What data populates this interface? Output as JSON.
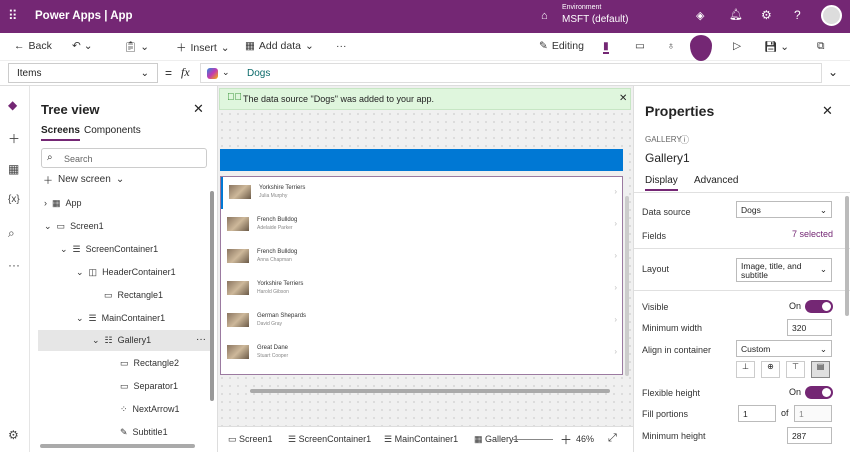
{
  "topbar": {
    "app_title": "Power Apps  |  App",
    "env_label": "Environment",
    "env_value": "MSFT (default)"
  },
  "toolbar": {
    "back": "Back",
    "insert": "Insert",
    "add_data": "Add data",
    "more": "···",
    "editing": "Editing"
  },
  "formula": {
    "property": "Items",
    "fx": "fx",
    "value": "Dogs"
  },
  "tree": {
    "title": "Tree view",
    "tabs": [
      "Screens",
      "Components"
    ],
    "search_placeholder": "Search",
    "new_screen": "New screen",
    "nodes": [
      "App",
      "Screen1",
      "ScreenContainer1",
      "HeaderContainer1",
      "Rectangle1",
      "MainContainer1",
      "Gallery1",
      "Rectangle2",
      "Separator1",
      "NextArrow1",
      "Subtitle1"
    ]
  },
  "notification": "The data source \"Dogs\" was added to your app.",
  "gallery": [
    {
      "title": "Yorkshire Terriers",
      "subtitle": "Julia Murphy"
    },
    {
      "title": "French Bulldog",
      "subtitle": "Adelaide Parker"
    },
    {
      "title": "French Bulldog",
      "subtitle": "Anna Chapman"
    },
    {
      "title": "Yorkshire Terriers",
      "subtitle": "Harold Gibson"
    },
    {
      "title": "German Shepards",
      "subtitle": "David Gray"
    },
    {
      "title": "Great Dane",
      "subtitle": "Stuart Cooper"
    }
  ],
  "breadcrumb": [
    "Screen1",
    "ScreenContainer1",
    "MainContainer1",
    "Gallery1"
  ],
  "zoom": "46%",
  "properties": {
    "title": "Properties",
    "type": "GALLERY",
    "name": "Gallery1",
    "tabs": [
      "Display",
      "Advanced"
    ],
    "data_source_label": "Data source",
    "data_source": "Dogs",
    "fields_label": "Fields",
    "fields_value": "7 selected",
    "layout_label": "Layout",
    "layout_value": "Image, title, and subtitle",
    "visible_label": "Visible",
    "visible_value": "On",
    "min_width_label": "Minimum width",
    "min_width": "320",
    "align_label": "Align in container",
    "align_value": "Custom",
    "flex_height_label": "Flexible height",
    "flex_height_value": "On",
    "fill_label": "Fill portions",
    "fill_value": "1",
    "of": "of",
    "fill_total": "1",
    "min_height_label": "Minimum height",
    "min_height": "287"
  },
  "colors": {
    "brand": "#742774",
    "accent": "#0078d4"
  }
}
